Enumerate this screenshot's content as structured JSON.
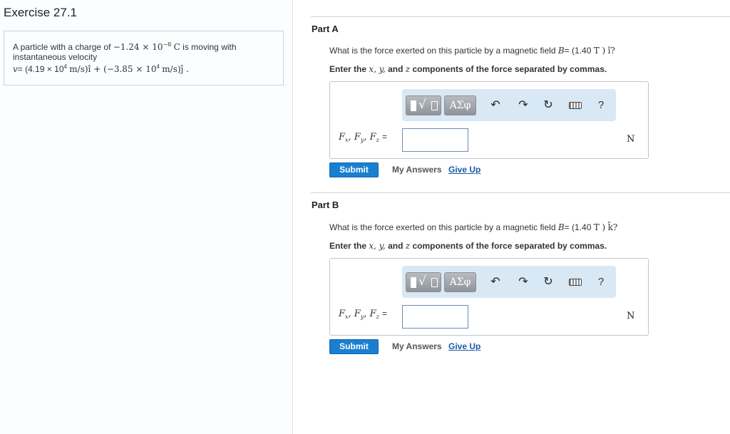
{
  "exercise": {
    "title": "Exercise 27.1",
    "problem_line1_prefix": "A particle with a charge of",
    "charge_value": "−1.24 × 10",
    "charge_exp": "−8",
    "charge_unit": "C",
    "problem_line1_suffix": "is moving with",
    "problem_line2": "instantaneous velocity",
    "velocity_symbol": "v",
    "velocity_eq": "= (4.19 × 10",
    "velocity_x_exp": "4",
    "velocity_x_unit": "m/s)î + (−3.85 × 10",
    "velocity_y_exp": "4",
    "velocity_y_unit": "m/s)ĵ ."
  },
  "parts": [
    {
      "title": "Part A",
      "question_prefix": "What is the force exerted on this particle by a magnetic field",
      "field_symbol": "B",
      "field_value": "= (1.40",
      "field_unit": "T )",
      "field_direction": "î?",
      "instruction_prefix": "Enter the",
      "instruction_vars": "x, y,",
      "instruction_and": "and",
      "instruction_z": "z",
      "instruction_suffix": "components of the force separated by commas.",
      "answer_label": "Fx, Fy, Fz =",
      "answer_value": "",
      "unit": "N",
      "submit_label": "Submit",
      "my_answers_label": "My Answers",
      "give_up_label": "Give Up"
    },
    {
      "title": "Part B",
      "question_prefix": "What is the force exerted on this particle by a magnetic field",
      "field_symbol": "B",
      "field_value": "= (1.40",
      "field_unit": "T )",
      "field_direction": "k̂?",
      "instruction_prefix": "Enter the",
      "instruction_vars": "x, y,",
      "instruction_and": "and",
      "instruction_z": "z",
      "instruction_suffix": "components of the force separated by commas.",
      "answer_label": "Fx, Fy, Fz =",
      "answer_value": "",
      "unit": "N",
      "submit_label": "Submit",
      "my_answers_label": "My Answers",
      "give_up_label": "Give Up"
    }
  ],
  "toolbar": {
    "greek_label": "ΑΣφ",
    "help_label": "?",
    "icons": [
      "templates-icon",
      "undo-icon",
      "redo-icon",
      "reset-icon",
      "keyboard-icon",
      "help-icon"
    ]
  },
  "colors": {
    "submit": "#1a7fd1",
    "link": "#1a5aa6",
    "toolbar_bg": "#d9e8f5"
  }
}
